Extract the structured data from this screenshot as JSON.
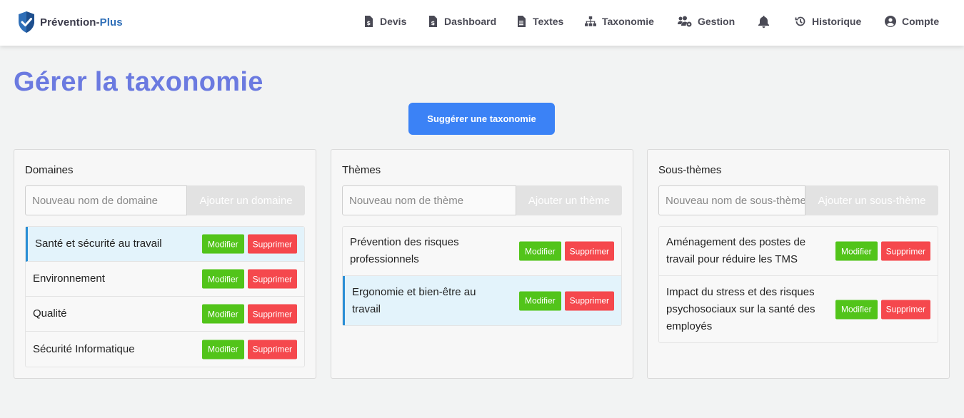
{
  "brand": {
    "name_part1": "Prévention-",
    "name_part2": "Plus"
  },
  "nav": {
    "devis": "Devis",
    "dashboard": "Dashboard",
    "textes": "Textes",
    "taxonomie": "Taxonomie",
    "gestion": "Gestion",
    "historique": "Historique",
    "compte": "Compte"
  },
  "page": {
    "title": "Gérer la taxonomie",
    "suggest_button": "Suggérer une taxonomie"
  },
  "domaines": {
    "title": "Domaines",
    "placeholder": "Nouveau nom de domaine",
    "add_label": "Ajouter un domaine",
    "items": [
      {
        "label": "Santé et sécurité au travail",
        "active": true
      },
      {
        "label": "Environnement",
        "active": false
      },
      {
        "label": "Qualité",
        "active": false
      },
      {
        "label": "Sécurité Informatique",
        "active": false
      }
    ]
  },
  "themes": {
    "title": "Thèmes",
    "placeholder": "Nouveau nom de thème",
    "add_label": "Ajouter un thème",
    "items": [
      {
        "label": "Prévention des risques professionnels",
        "active": false
      },
      {
        "label": "Ergonomie et bien-être au travail",
        "active": true
      }
    ]
  },
  "sous_themes": {
    "title": "Sous-thèmes",
    "placeholder": "Nouveau nom de sous-thème",
    "add_label": "Ajouter un sous-thème",
    "items": [
      {
        "label": "Aménagement des postes de travail pour réduire les TMS",
        "active": false
      },
      {
        "label": "Impact du stress et des risques psychosociaux sur la santé des employés",
        "active": false
      }
    ]
  },
  "actions": {
    "edit": "Modifier",
    "delete": "Supprimer"
  },
  "colors": {
    "title": "#6b7ae0",
    "primary": "#3b82f6",
    "edit": "#52c41a",
    "delete": "#f5484d",
    "active_border": "#2b8fd6",
    "active_bg": "#e3f3fb"
  }
}
